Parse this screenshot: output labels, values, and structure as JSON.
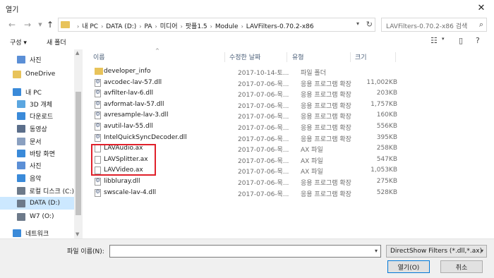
{
  "window": {
    "title": "열기"
  },
  "nav": {
    "breadcrumbs": [
      "내 PC",
      "DATA (D:)",
      "PA",
      "미디어",
      "팟플1.5",
      "Module",
      "LAVFilters-0.70.2-x86"
    ],
    "search_placeholder": "LAVFilters-0.70.2-x86 검색"
  },
  "toolbar": {
    "organize": "구성 ▾",
    "new_folder": "새 폴더"
  },
  "sidebar": {
    "items": [
      {
        "label": "사진",
        "icon": "pictures-icon",
        "color": "#5b8fd6"
      },
      {
        "label": "OneDrive",
        "icon": "onedrive-icon",
        "color": "#e8c35a"
      },
      {
        "label": "내 PC",
        "icon": "pc-icon",
        "color": "#3a8ad9"
      },
      {
        "label": "3D 개체",
        "icon": "3d-objects-icon",
        "color": "#5ba6e0"
      },
      {
        "label": "다운로드",
        "icon": "downloads-icon",
        "color": "#3a8ad9"
      },
      {
        "label": "동영상",
        "icon": "videos-icon",
        "color": "#5b6e8a"
      },
      {
        "label": "문서",
        "icon": "documents-icon",
        "color": "#8aa0c0"
      },
      {
        "label": "바탕 화면",
        "icon": "desktop-icon",
        "color": "#3a8ad9"
      },
      {
        "label": "사진",
        "icon": "pictures-icon",
        "color": "#5b8fd6"
      },
      {
        "label": "음악",
        "icon": "music-icon",
        "color": "#3a8ad9"
      },
      {
        "label": "로컬 디스크 (C:)",
        "icon": "drive-icon",
        "color": "#6d7a8a"
      },
      {
        "label": "DATA (D:)",
        "icon": "drive-icon",
        "color": "#6d7a8a"
      },
      {
        "label": "W7 (O:)",
        "icon": "drive-icon",
        "color": "#6d7a8a"
      },
      {
        "label": "네트워크",
        "icon": "network-icon",
        "color": "#3a8ad9"
      }
    ]
  },
  "columns": {
    "name": "이름",
    "date": "수정한 날짜",
    "type": "유형",
    "size": "크기"
  },
  "files": [
    {
      "name": "developer_info",
      "date": "2017-10-14-토...",
      "type": "파일 폴더",
      "size": "",
      "kind": "folder"
    },
    {
      "name": "avcodec-lav-57.dll",
      "date": "2017-07-06-목...",
      "type": "응용 프로그램 확장",
      "size": "11,002KB",
      "kind": "dll"
    },
    {
      "name": "avfilter-lav-6.dll",
      "date": "2017-07-06-목...",
      "type": "응용 프로그램 확장",
      "size": "203KB",
      "kind": "dll"
    },
    {
      "name": "avformat-lav-57.dll",
      "date": "2017-07-06-목...",
      "type": "응용 프로그램 확장",
      "size": "1,757KB",
      "kind": "dll"
    },
    {
      "name": "avresample-lav-3.dll",
      "date": "2017-07-06-목...",
      "type": "응용 프로그램 확장",
      "size": "160KB",
      "kind": "dll"
    },
    {
      "name": "avutil-lav-55.dll",
      "date": "2017-07-06-목...",
      "type": "응용 프로그램 확장",
      "size": "556KB",
      "kind": "dll"
    },
    {
      "name": "IntelQuickSyncDecoder.dll",
      "date": "2017-07-06-목...",
      "type": "응용 프로그램 확장",
      "size": "395KB",
      "kind": "dll"
    },
    {
      "name": "LAVAudio.ax",
      "date": "2017-07-06-목...",
      "type": "AX 파일",
      "size": "258KB",
      "kind": "ax"
    },
    {
      "name": "LAVSplitter.ax",
      "date": "2017-07-06-목...",
      "type": "AX 파일",
      "size": "547KB",
      "kind": "ax"
    },
    {
      "name": "LAVVideo.ax",
      "date": "2017-07-06-목...",
      "type": "AX 파일",
      "size": "1,053KB",
      "kind": "ax"
    },
    {
      "name": "libbluray.dll",
      "date": "2017-07-06-목...",
      "type": "응용 프로그램 확장",
      "size": "275KB",
      "kind": "dll"
    },
    {
      "name": "swscale-lav-4.dll",
      "date": "2017-07-06-목...",
      "type": "응용 프로그램 확장",
      "size": "528KB",
      "kind": "dll"
    }
  ],
  "bottom": {
    "filename_label": "파일 이름(N):",
    "filename_value": "",
    "filter": "DirectShow Filters (*.dll,*.ax)",
    "open": "열기(O)",
    "cancel": "취소"
  }
}
